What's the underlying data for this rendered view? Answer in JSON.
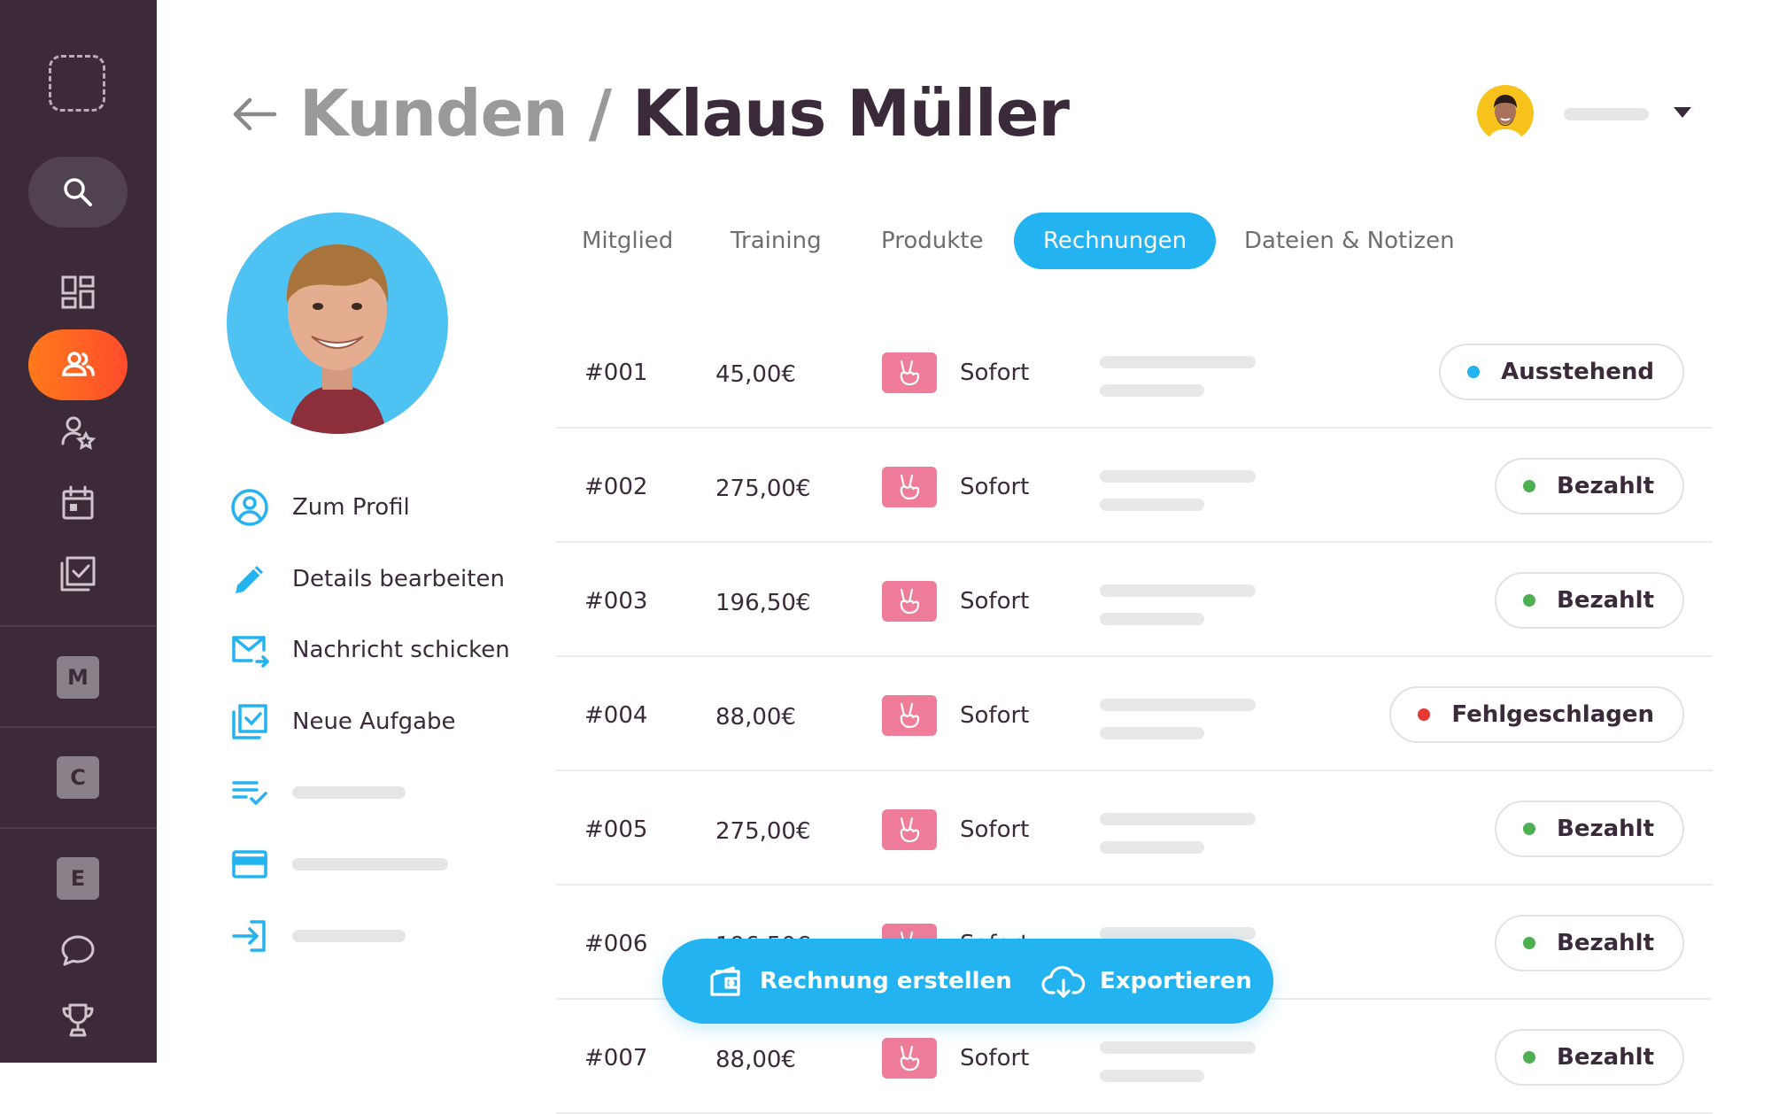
{
  "sidebar": {
    "workspaces": [
      "M",
      "C",
      "E"
    ]
  },
  "header": {
    "breadcrumb_root": "Kunden",
    "breadcrumb_separator": "/",
    "breadcrumb_current": "Klaus Müller"
  },
  "tabs": [
    {
      "label": "Mitglied",
      "active": false
    },
    {
      "label": "Training",
      "active": false
    },
    {
      "label": "Produkte",
      "active": false
    },
    {
      "label": "Rechnungen",
      "active": true
    },
    {
      "label": "Dateien & Notizen",
      "active": false
    }
  ],
  "actions": [
    {
      "label": "Zum Profil",
      "icon": "user-circle-icon"
    },
    {
      "label": "Details bearbeiten",
      "icon": "pencil-icon"
    },
    {
      "label": "Nachricht schicken",
      "icon": "mail-send-icon"
    },
    {
      "label": "Neue Aufgabe",
      "icon": "task-check-icon"
    },
    {
      "label": "",
      "icon": "checklist-icon"
    },
    {
      "label": "",
      "icon": "credit-card-icon"
    },
    {
      "label": "",
      "icon": "login-icon"
    }
  ],
  "invoices": [
    {
      "number": "#001",
      "amount": "45,00€",
      "method": "Sofort",
      "status": "Ausstehend",
      "status_color": "#23b3f0"
    },
    {
      "number": "#002",
      "amount": "275,00€",
      "method": "Sofort",
      "status": "Bezahlt",
      "status_color": "#4caf50"
    },
    {
      "number": "#003",
      "amount": "196,50€",
      "method": "Sofort",
      "status": "Bezahlt",
      "status_color": "#4caf50"
    },
    {
      "number": "#004",
      "amount": "88,00€",
      "method": "Sofort",
      "status": "Fehlgeschlagen",
      "status_color": "#e53935"
    },
    {
      "number": "#005",
      "amount": "275,00€",
      "method": "Sofort",
      "status": "Bezahlt",
      "status_color": "#4caf50"
    },
    {
      "number": "#006",
      "amount": "196,50€",
      "method": "Sofort",
      "status": "Bezahlt",
      "status_color": "#4caf50"
    },
    {
      "number": "#007",
      "amount": "88,00€",
      "method": "Sofort",
      "status": "Bezahlt",
      "status_color": "#4caf50"
    }
  ],
  "fab": {
    "create_label": "Rechnung erstellen",
    "export_label": "Exportieren"
  },
  "colors": {
    "sidebar_bg": "#3c2a38",
    "accent_blue": "#23b3f0",
    "active_nav": "#ff5a26",
    "payment_badge": "#ef7c99"
  }
}
